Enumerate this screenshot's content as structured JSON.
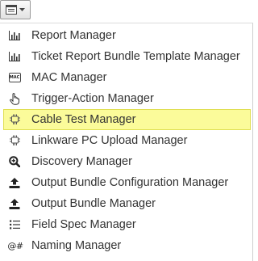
{
  "toolbar": {
    "menu_button_icon": "list-icon",
    "dropdown_arrow_icon": "caret-down-icon"
  },
  "highlight_color": "#fbfb9a",
  "menu": {
    "items": [
      {
        "label": "Report Manager",
        "icon": "bar-chart-icon"
      },
      {
        "label": "Ticket Report Bundle Template Manager",
        "icon": "bar-chart-icon"
      },
      {
        "label": "MAC Manager",
        "icon": "mac-icon",
        "icon_text": "MAC"
      },
      {
        "label": "Trigger-Action Manager",
        "icon": "pointer-hand-icon"
      },
      {
        "label": "Cable Test Manager",
        "icon": "cable-test-icon",
        "highlighted": true
      },
      {
        "label": "Linkware PC Upload Manager",
        "icon": "cable-test-icon"
      },
      {
        "label": "Discovery Manager",
        "icon": "search-plus-icon"
      },
      {
        "label": "Output Bundle Configuration Manager",
        "icon": "upload-icon"
      },
      {
        "label": "Output Bundle Manager",
        "icon": "upload-icon"
      },
      {
        "label": "Field Spec Manager",
        "icon": "list-bullets-icon"
      },
      {
        "label": "Naming Manager",
        "icon": "at-hash-icon",
        "icon_text": "@#"
      }
    ]
  }
}
